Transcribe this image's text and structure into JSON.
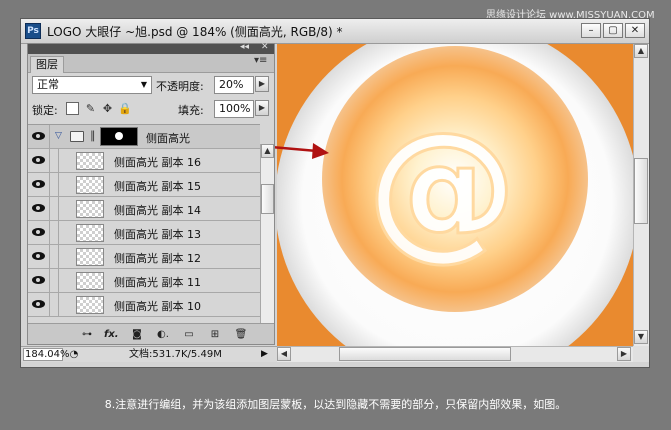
{
  "watermark": "思缘设计论坛 www.MISSYUAN.COM",
  "window": {
    "app_icon": "Ps",
    "title": "LOGO 大眼仔 ~旭.psd @ 184% (侧面高光, RGB/8) *",
    "minimize": "–",
    "maximize": "▢",
    "close": "✕"
  },
  "layers_panel": {
    "collapse": "◂◂",
    "close": "✕",
    "menu": "▾≡",
    "tab": "图层",
    "blend_mode": "正常",
    "opacity_label": "不透明度:",
    "opacity_value": "20%",
    "lock_label": "锁定:",
    "lock_icons": [
      "lock-transparent-icon",
      "lock-image-icon",
      "lock-position-icon",
      "lock-all-icon"
    ],
    "fill_label": "填充:",
    "fill_value": "100%",
    "group": {
      "name": "侧面高光",
      "expanded": true
    },
    "layers": [
      {
        "name": "侧面高光 副本 16"
      },
      {
        "name": "侧面高光 副本 15"
      },
      {
        "name": "侧面高光 副本 14"
      },
      {
        "name": "侧面高光 副本 13"
      },
      {
        "name": "侧面高光 副本 12"
      },
      {
        "name": "侧面高光 副本 11"
      },
      {
        "name": "侧面高光 副本 10"
      }
    ],
    "footer_icons": [
      "link-layers-icon",
      "fx-icon",
      "add-mask-icon",
      "adjustment-layer-icon",
      "new-group-icon",
      "new-layer-icon",
      "delete-layer-icon"
    ],
    "footer_glyphs": [
      "⊶",
      "fx.",
      "◙",
      "◐.",
      "▭",
      "⊞",
      "🗑"
    ]
  },
  "status": {
    "zoom": "184.04%",
    "doc": "文档:531.7K/5.49M"
  },
  "canvas": {
    "symbol": "@",
    "background_color": "#e98a2f",
    "arrow_color": "#b01212"
  },
  "caption": "8.注意进行编组，并为该组添加图层蒙板，以达到隐藏不需要的部分，只保留内部效果，如图。"
}
